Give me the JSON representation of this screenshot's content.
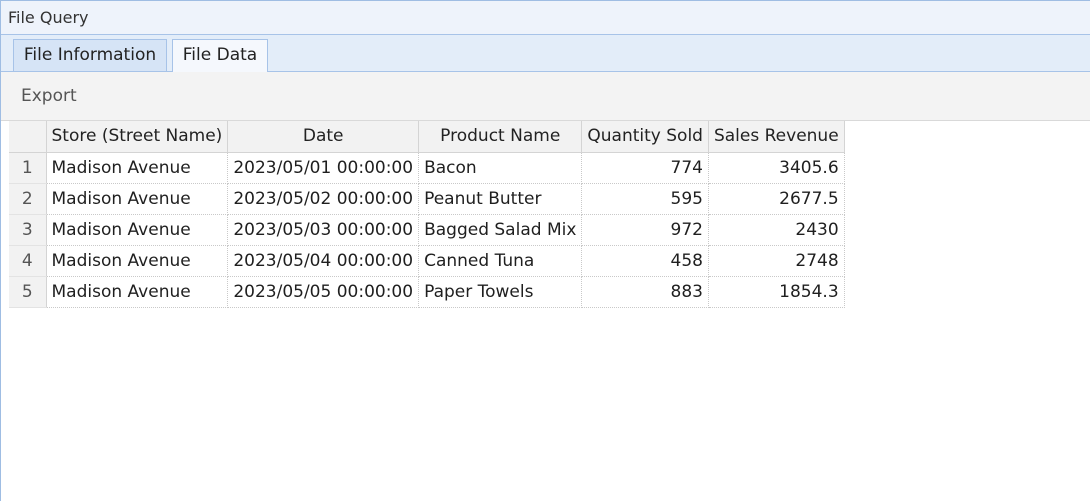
{
  "window": {
    "title": "File Query"
  },
  "tabs": [
    {
      "label": "File Information",
      "active": false
    },
    {
      "label": "File Data",
      "active": true
    }
  ],
  "toolbar": {
    "export_label": "Export"
  },
  "table": {
    "columns": [
      "",
      "Store (Street Name)",
      "Date",
      "Product Name",
      "Quantity Sold",
      "Sales Revenue"
    ],
    "rows": [
      [
        "1",
        "Madison Avenue",
        "2023/05/01 00:00:00",
        "Bacon",
        "774",
        "3405.6"
      ],
      [
        "2",
        "Madison Avenue",
        "2023/05/02 00:00:00",
        "Peanut Butter",
        "595",
        "2677.5"
      ],
      [
        "3",
        "Madison Avenue",
        "2023/05/03 00:00:00",
        "Bagged Salad Mix",
        "972",
        "2430"
      ],
      [
        "4",
        "Madison Avenue",
        "2023/05/04 00:00:00",
        "Canned Tuna",
        "458",
        "2748"
      ],
      [
        "5",
        "Madison Avenue",
        "2023/05/05 00:00:00",
        "Paper Towels",
        "883",
        "1854.3"
      ]
    ]
  },
  "colors": {
    "titlebar_bg": "#eef3fb",
    "tabstrip_bg": "#e3edf9",
    "border_accent": "#a7c3e8",
    "toolbar_bg": "#f3f3f3",
    "header_bg": "#f2f2f2"
  }
}
